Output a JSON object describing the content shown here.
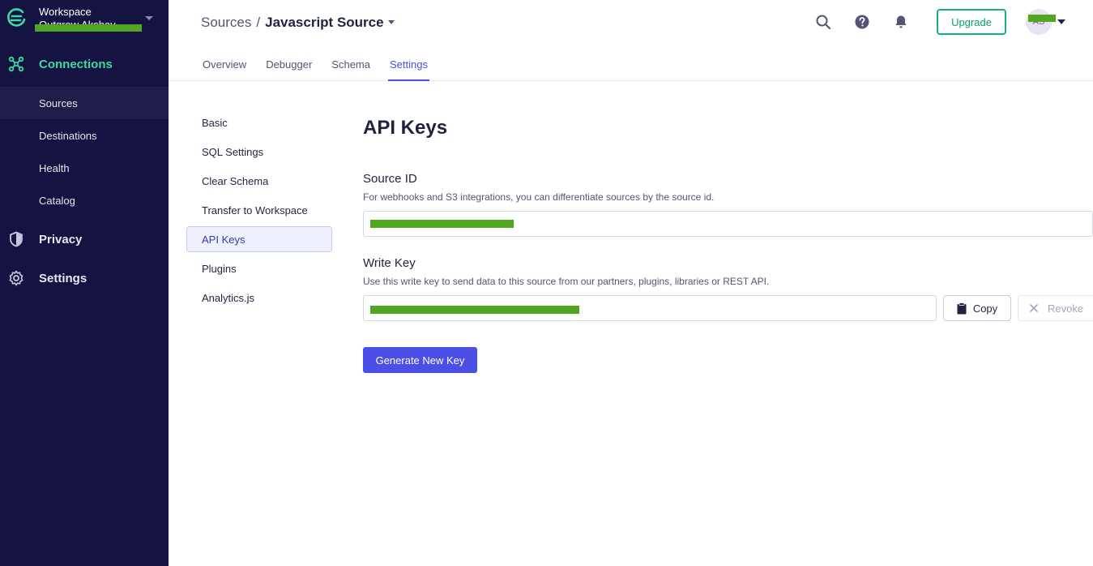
{
  "workspace": {
    "label": "Workspace",
    "name": "Outgrow Akshay"
  },
  "sidebar": {
    "connections": "Connections",
    "items": [
      {
        "label": "Sources"
      },
      {
        "label": "Destinations"
      },
      {
        "label": "Health"
      },
      {
        "label": "Catalog"
      }
    ],
    "privacy": "Privacy",
    "settings": "Settings"
  },
  "header": {
    "breadcrumb_root": "Sources",
    "breadcrumb_sep": "/",
    "breadcrumb_current": "Javascript Source",
    "upgrade": "Upgrade",
    "avatar_initials": "AS"
  },
  "tabs": [
    {
      "label": "Overview"
    },
    {
      "label": "Debugger"
    },
    {
      "label": "Schema"
    },
    {
      "label": "Settings"
    }
  ],
  "subnav": [
    {
      "label": "Basic"
    },
    {
      "label": "SQL Settings"
    },
    {
      "label": "Clear Schema"
    },
    {
      "label": "Transfer to Workspace"
    },
    {
      "label": "API Keys"
    },
    {
      "label": "Plugins"
    },
    {
      "label": "Analytics.js"
    }
  ],
  "main": {
    "title": "API Keys",
    "source_id": {
      "label": "Source ID",
      "help": "For webhooks and S3 integrations, you can differentiate sources by the source id."
    },
    "write_key": {
      "label": "Write Key",
      "help": "Use this write key to send data to this source from our partners, plugins, libraries or REST API.",
      "copy": "Copy",
      "revoke": "Revoke"
    },
    "generate": "Generate New Key"
  },
  "colors": {
    "sidebar_bg": "#141341",
    "accent": "#4b4fe5",
    "connections_green": "#3fd8a5",
    "upgrade_green": "#11b57a"
  }
}
